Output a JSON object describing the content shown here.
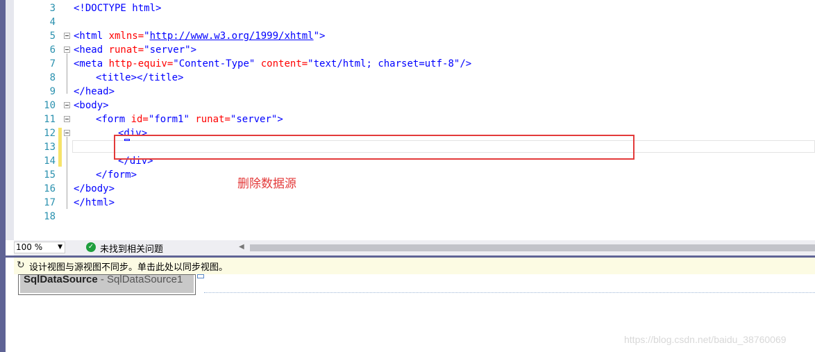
{
  "editor": {
    "line_numbers": [
      "3",
      "4",
      "5",
      "6",
      "7",
      "8",
      "9",
      "10",
      "11",
      "12",
      "13",
      "14",
      "15",
      "16",
      "17",
      "18"
    ],
    "lines": {
      "l3": "<!DOCTYPE html>",
      "l5_open": "<html ",
      "l5_attr": "xmlns=",
      "l5_q1": "\"",
      "l5_url": "http://www.w3.org/1999/xhtml",
      "l5_q2": "\"",
      "l5_close": ">",
      "l6_open": "<head ",
      "l6_attr": "runat=",
      "l6_val": "\"server\"",
      "l6_close": ">",
      "l7_open": "<meta ",
      "l7_attr1": "http-equiv=",
      "l7_val1": "\"Content-Type\"",
      "l7_attr2": " content=",
      "l7_val2": "\"text/html; charset=utf-8\"",
      "l7_close": "/>",
      "l8": "<title></title>",
      "l9": "</head>",
      "l10": "<body>",
      "l11_open": "<form ",
      "l11_attr1": "id=",
      "l11_val1": "\"form1\"",
      "l11_attr2": " runat=",
      "l11_val2": "\"server\"",
      "l11_close": ">",
      "l12": "<div>",
      "l14": "</div>",
      "l15": "</form>",
      "l16": "</body>",
      "l17": "</html>"
    }
  },
  "annotation": {
    "text": "删除数据源"
  },
  "statusbar": {
    "zoom": "100 %",
    "issues": "未找到相关问题"
  },
  "infobar": {
    "message": "设计视图与源视图不同步。单击此处以同步视图。"
  },
  "design": {
    "control_type": "SqlDataSource",
    "control_sep": " - ",
    "control_id": "SqlDataSource1"
  },
  "watermark": "https://blog.csdn.net/baidu_38760069",
  "colors": {
    "accent_strip": "#5f6395",
    "annotation_red": "#e33a3a",
    "line_number": "#2b91af"
  }
}
